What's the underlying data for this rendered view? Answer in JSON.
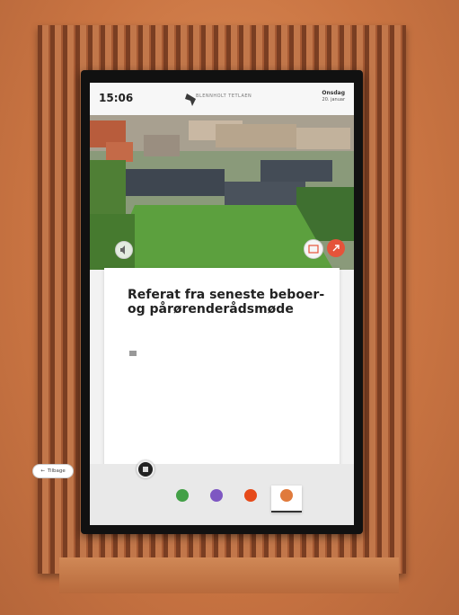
{
  "header": {
    "time": "15:06",
    "logo_text": "BLENNHOLT TETLAEN",
    "day": "Onsdag",
    "date": "20. januar"
  },
  "card": {
    "title": "Referat fra seneste beboer- og pårørenderådsmøde",
    "meta": "",
    "paragraphs": [
      "",
      "",
      ""
    ]
  },
  "footer": {
    "back_label": "Tilbage",
    "nav": [
      {
        "label": "",
        "color": "#43a047"
      },
      {
        "label": "",
        "color": "#7e57c2"
      },
      {
        "label": "",
        "color": "#e64a19"
      },
      {
        "label": "",
        "color": "#e07a3c"
      }
    ]
  },
  "colors": {
    "accent_red": "#e5533a",
    "grass": "#5ca03e"
  }
}
